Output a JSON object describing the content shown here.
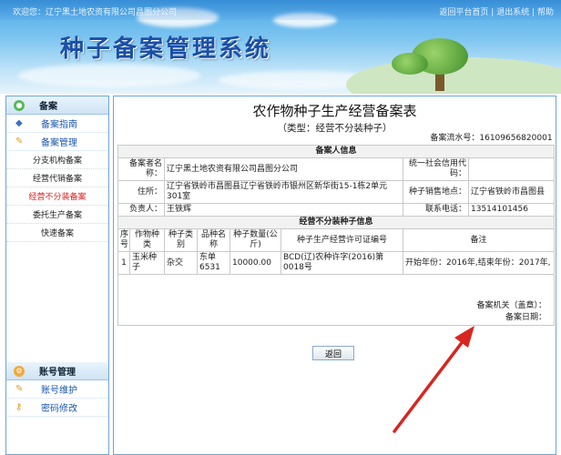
{
  "header": {
    "welcome": "欢迎您：辽宁黑土地农资有限公司昌图分公司",
    "links": [
      "返回平台首页",
      "退出系统",
      "帮助"
    ],
    "title": "种子备案管理系统"
  },
  "sidebar": {
    "group1": {
      "label": "备案",
      "subs": [
        {
          "label": "备案指南",
          "icon": "book-icon"
        },
        {
          "label": "备案管理",
          "icon": "pen-icon"
        }
      ],
      "items": [
        "分支机构备案",
        "经营代销备案",
        "经营不分装备案",
        "委托生产备案",
        "快速备案"
      ],
      "active_index": 2
    },
    "group2": {
      "label": "账号管理",
      "subs": [
        {
          "label": "账号维护",
          "icon": "pen-icon"
        },
        {
          "label": "密码修改",
          "icon": "key-icon"
        }
      ]
    }
  },
  "form": {
    "title": "农作物种子生产经营备案表",
    "subtitle": "（类型：经营不分装种子）",
    "serial": "备案流水号：16109656820001",
    "section1": "备案人信息",
    "filer_label": "备案者名称：",
    "filer_value": "辽宁黑土地农资有限公司昌图分公司",
    "credit_label": "统一社会信用代码：",
    "credit_value": "",
    "address_label": "住所：",
    "address_value": "辽宁省铁岭市昌图县辽宁省铁岭市银州区新华街15-1栋2单元301室",
    "sales_label": "种子销售地点：",
    "sales_value": "辽宁省铁岭市昌图县",
    "person_label": "负责人：",
    "person_value": "王铁辉",
    "phone_label": "联系电话：",
    "phone_value": "13514101456",
    "section2": "经营不分装种子信息",
    "columns": [
      "序号",
      "作物种类",
      "种子类别",
      "品种名称",
      "种子数量(公斤)",
      "种子生产经营许可证编号",
      "备注"
    ],
    "rows": [
      [
        "1",
        "玉米种子",
        "杂交",
        "东单6531",
        "10000.00",
        "BCD(辽)农种许字(2016)第0018号",
        "开始年份：2016年,结束年份：2017年,"
      ]
    ],
    "sign_authority": "备案机关（盖章）：",
    "sign_date": "备案日期：",
    "back_label": "返回"
  }
}
